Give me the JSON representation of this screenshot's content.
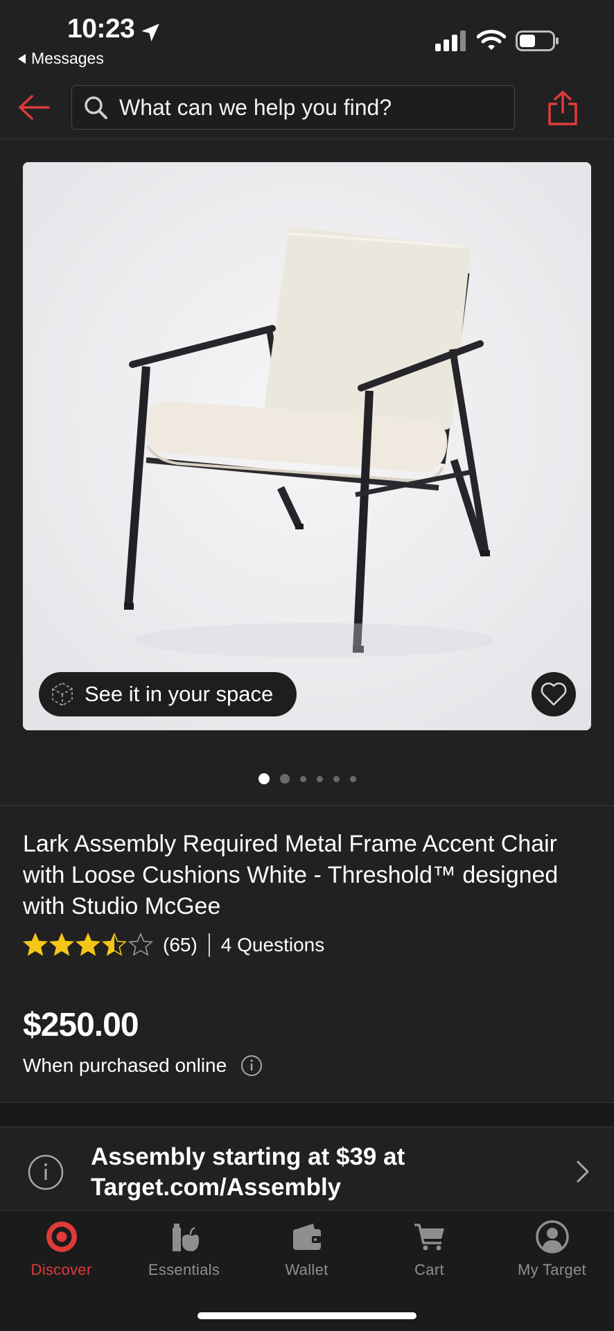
{
  "status_bar": {
    "time": "10:23",
    "back_app_label": "Messages"
  },
  "header": {
    "search_placeholder": "What can we help you find?"
  },
  "gallery": {
    "ar_button_label": "See it in your space",
    "image_count": 6,
    "active_index": 0
  },
  "product": {
    "title": "Lark Assembly Required Metal Frame Accent Chair with Loose Cushions White - Threshold™ designed with Studio McGee",
    "rating": 3.5,
    "rating_max": 5,
    "rating_count": "(65)",
    "questions": "4 Questions",
    "price": "$250.00",
    "price_note": "When purchased online"
  },
  "assembly_banner": {
    "text": "Assembly starting at $39 at Target.com/Assembly"
  },
  "tab_bar": {
    "tabs": [
      {
        "label": "Discover",
        "icon": "bullseye-icon",
        "active": true
      },
      {
        "label": "Essentials",
        "icon": "essentials-icon",
        "active": false
      },
      {
        "label": "Wallet",
        "icon": "wallet-icon",
        "active": false
      },
      {
        "label": "Cart",
        "icon": "cart-icon",
        "active": false
      },
      {
        "label": "My Target",
        "icon": "profile-icon",
        "active": false
      }
    ]
  },
  "colors": {
    "background": "#212121",
    "accent_red": "#e03a3a",
    "star_gold": "#f5c518"
  }
}
